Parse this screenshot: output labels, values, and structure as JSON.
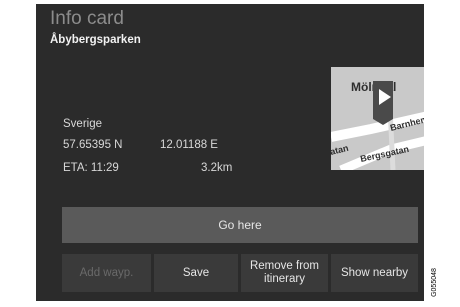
{
  "header": {
    "title": "Info card",
    "place_name": "Åbybergsparken"
  },
  "details": {
    "country": "Sverige",
    "latitude": "57.65395 N",
    "longitude": "12.01188 E",
    "eta": "ETA:  11:29",
    "distance": "3.2km"
  },
  "map": {
    "labels": {
      "city": "Mölndal",
      "street_1": "Barnhemsga",
      "street_2": "atan",
      "street_3": "Bergsgatan"
    },
    "icon": "play-icon"
  },
  "actions": {
    "go_here": "Go here",
    "add_waypoint": "Add wayp.",
    "save": "Save",
    "remove_from_itinerary": "Remove from itinerary",
    "show_nearby": "Show nearby"
  },
  "reference_code": "G055048",
  "colors": {
    "screen_bg": "#2b2b2b",
    "primary_button": "#5a5a5a",
    "secondary_button": "#3a3a3a",
    "disabled_text": "#6a6a6a"
  }
}
